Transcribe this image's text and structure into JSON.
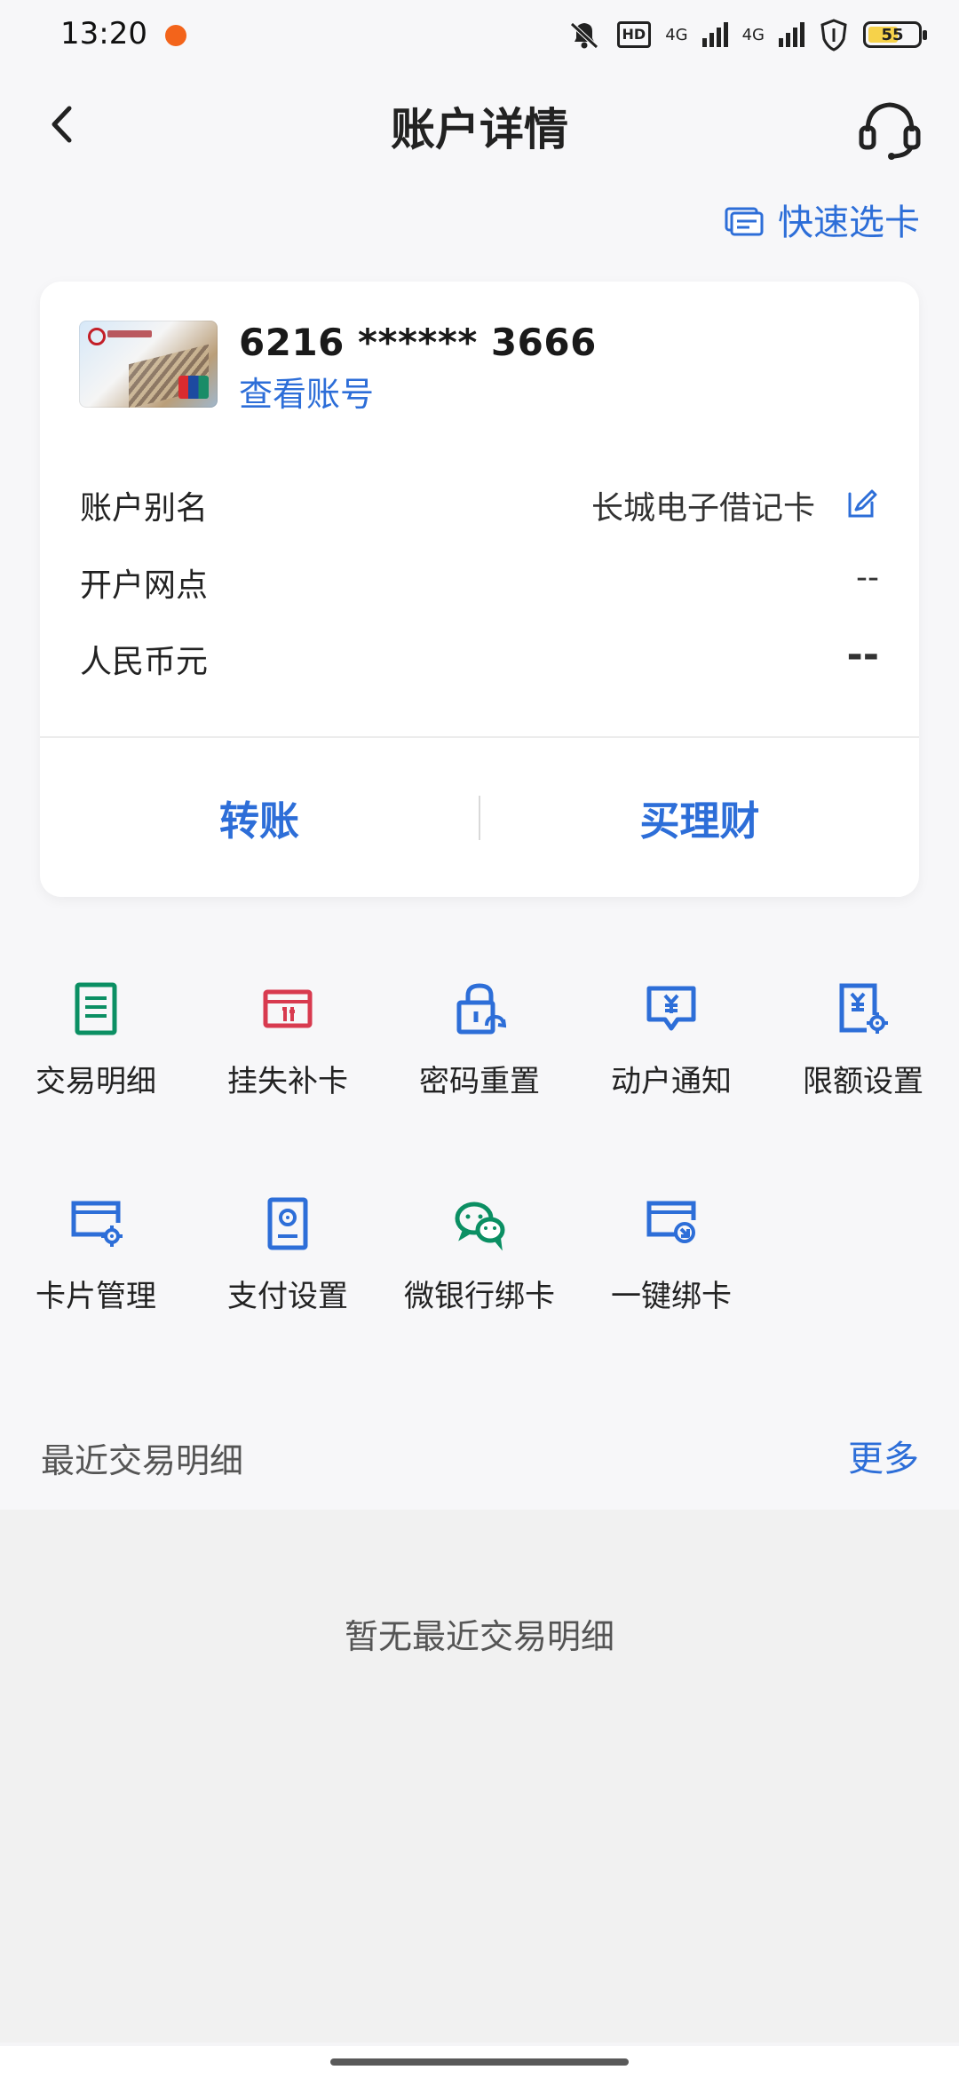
{
  "status_bar": {
    "time": "13:20",
    "hd": "HD",
    "network_1": "4G",
    "network_2": "4G",
    "battery": "55",
    "colors": {
      "accent": "#f3641b"
    }
  },
  "header": {
    "title": "账户详情",
    "back_icon": "chevron-left-icon",
    "support_icon": "headset-icon"
  },
  "quick_select": {
    "label": "快速选卡",
    "icon": "card-stack-icon"
  },
  "account_card": {
    "card_number": "6216 ****** 3666",
    "view_account": "查看账号",
    "rows": [
      {
        "label": "账户别名",
        "value": "长城电子借记卡",
        "editable": true,
        "edit_icon": "edit-icon"
      },
      {
        "label": "开户网点",
        "value": "--"
      },
      {
        "label": "人民币元",
        "value": "--"
      }
    ],
    "actions": [
      {
        "label": "转账"
      },
      {
        "label": "买理财"
      }
    ]
  },
  "services": [
    {
      "label": "交易明细",
      "icon": "transaction-detail-icon",
      "color": "#0b8f63"
    },
    {
      "label": "挂失补卡",
      "icon": "lost-card-icon",
      "color": "#d83a4f"
    },
    {
      "label": "密码重置",
      "icon": "password-reset-icon",
      "color": "#2d6ed8"
    },
    {
      "label": "动户通知",
      "icon": "notification-icon",
      "color": "#2d6ed8"
    },
    {
      "label": "限额设置",
      "icon": "limit-settings-icon",
      "color": "#2d6ed8"
    },
    {
      "label": "卡片管理",
      "icon": "card-management-icon",
      "color": "#2d6ed8"
    },
    {
      "label": "支付设置",
      "icon": "payment-settings-icon",
      "color": "#2d6ed8"
    },
    {
      "label": "微银行绑卡",
      "icon": "wechat-bank-icon",
      "color": "#0b8f63"
    },
    {
      "label": "一键绑卡",
      "icon": "one-click-bind-icon",
      "color": "#2d6ed8"
    }
  ],
  "recent": {
    "title": "最近交易明细",
    "more": "更多",
    "empty_text": "暂无最近交易明细"
  }
}
